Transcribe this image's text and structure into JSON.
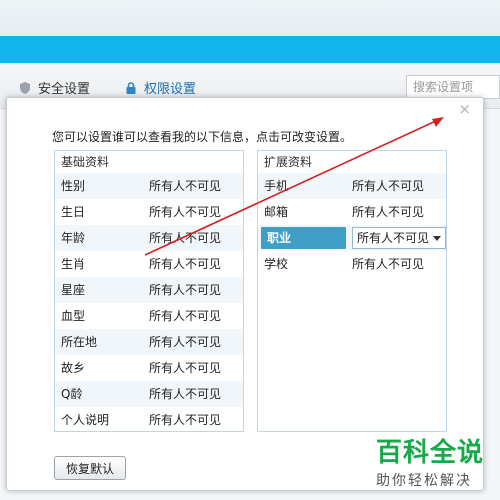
{
  "bg": {
    "tab_security": "安全设置",
    "tab_permission": "权限设置",
    "search_placeholder": "搜索设置项"
  },
  "dialog": {
    "close": "×",
    "intro": "您可以设置谁可以查看我的以下信息，点击可改变设置。",
    "basic": {
      "title": "基础资料",
      "rows": [
        {
          "k": "性别",
          "v": "所有人不可见"
        },
        {
          "k": "生日",
          "v": "所有人不可见"
        },
        {
          "k": "年龄",
          "v": "所有人不可见"
        },
        {
          "k": "生肖",
          "v": "所有人不可见"
        },
        {
          "k": "星座",
          "v": "所有人不可见"
        },
        {
          "k": "血型",
          "v": "所有人不可见"
        },
        {
          "k": "所在地",
          "v": "所有人不可见"
        },
        {
          "k": "故乡",
          "v": "所有人不可见"
        },
        {
          "k": "Q龄",
          "v": "所有人不可见"
        },
        {
          "k": "个人说明",
          "v": "所有人不可见"
        }
      ]
    },
    "ext": {
      "title": "扩展资料",
      "rows": [
        {
          "k": "手机",
          "v": "所有人不可见"
        },
        {
          "k": "邮箱",
          "v": "所有人不可见"
        },
        {
          "k": "职业",
          "v": "所有人不可见"
        },
        {
          "k": "学校",
          "v": "所有人不可见"
        }
      ]
    },
    "reset_label": "恢复默认"
  },
  "watermark": {
    "line1": "百科全说",
    "line2": "助你轻松解决"
  },
  "colors": {
    "blue_bar": "#11b4ef",
    "selected": "#3f9fc7",
    "arrow": "#d42020",
    "watermark": "#17a84a"
  }
}
